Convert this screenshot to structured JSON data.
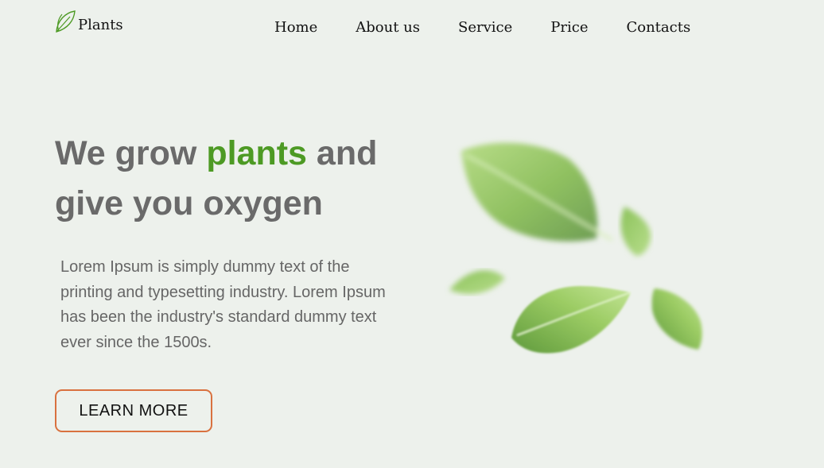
{
  "brand": {
    "name": "Plants",
    "icon": "leaf-icon",
    "icon_color": "#4d9a24"
  },
  "nav": {
    "items": [
      {
        "label": "Home"
      },
      {
        "label": "About us"
      },
      {
        "label": "Service"
      },
      {
        "label": "Price"
      },
      {
        "label": "Contacts"
      }
    ]
  },
  "hero": {
    "title_part1": "We grow ",
    "title_accent": "plants",
    "title_part2": " and give you oxygen",
    "description": "Lorem Ipsum is simply dummy text of the printing and typesetting industry. Lorem Ipsum has been the industry's standard dummy text ever since the 1500s.",
    "cta_label": "LEARN MORE",
    "image": "falling-green-leaves"
  },
  "colors": {
    "background": "#edf1ec",
    "accent": "#4d9a24",
    "heading": "#6a6a6a",
    "button_border": "#d9713f"
  }
}
